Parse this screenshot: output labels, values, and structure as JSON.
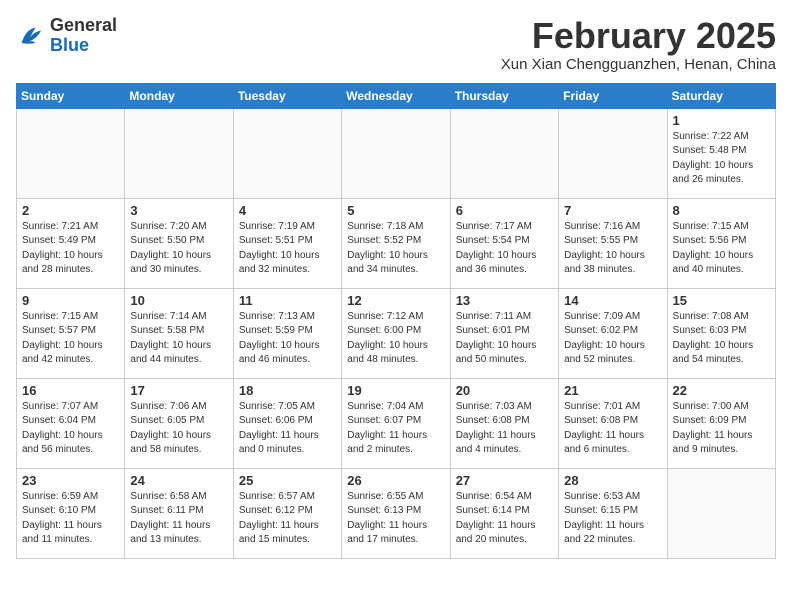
{
  "header": {
    "logo_general": "General",
    "logo_blue": "Blue",
    "month_title": "February 2025",
    "subtitle": "Xun Xian Chengguanzhen, Henan, China"
  },
  "weekdays": [
    "Sunday",
    "Monday",
    "Tuesday",
    "Wednesday",
    "Thursday",
    "Friday",
    "Saturday"
  ],
  "weeks": [
    [
      {
        "day": "",
        "info": ""
      },
      {
        "day": "",
        "info": ""
      },
      {
        "day": "",
        "info": ""
      },
      {
        "day": "",
        "info": ""
      },
      {
        "day": "",
        "info": ""
      },
      {
        "day": "",
        "info": ""
      },
      {
        "day": "1",
        "info": "Sunrise: 7:22 AM\nSunset: 5:48 PM\nDaylight: 10 hours and 26 minutes."
      }
    ],
    [
      {
        "day": "2",
        "info": "Sunrise: 7:21 AM\nSunset: 5:49 PM\nDaylight: 10 hours and 28 minutes."
      },
      {
        "day": "3",
        "info": "Sunrise: 7:20 AM\nSunset: 5:50 PM\nDaylight: 10 hours and 30 minutes."
      },
      {
        "day": "4",
        "info": "Sunrise: 7:19 AM\nSunset: 5:51 PM\nDaylight: 10 hours and 32 minutes."
      },
      {
        "day": "5",
        "info": "Sunrise: 7:18 AM\nSunset: 5:52 PM\nDaylight: 10 hours and 34 minutes."
      },
      {
        "day": "6",
        "info": "Sunrise: 7:17 AM\nSunset: 5:54 PM\nDaylight: 10 hours and 36 minutes."
      },
      {
        "day": "7",
        "info": "Sunrise: 7:16 AM\nSunset: 5:55 PM\nDaylight: 10 hours and 38 minutes."
      },
      {
        "day": "8",
        "info": "Sunrise: 7:15 AM\nSunset: 5:56 PM\nDaylight: 10 hours and 40 minutes."
      }
    ],
    [
      {
        "day": "9",
        "info": "Sunrise: 7:15 AM\nSunset: 5:57 PM\nDaylight: 10 hours and 42 minutes."
      },
      {
        "day": "10",
        "info": "Sunrise: 7:14 AM\nSunset: 5:58 PM\nDaylight: 10 hours and 44 minutes."
      },
      {
        "day": "11",
        "info": "Sunrise: 7:13 AM\nSunset: 5:59 PM\nDaylight: 10 hours and 46 minutes."
      },
      {
        "day": "12",
        "info": "Sunrise: 7:12 AM\nSunset: 6:00 PM\nDaylight: 10 hours and 48 minutes."
      },
      {
        "day": "13",
        "info": "Sunrise: 7:11 AM\nSunset: 6:01 PM\nDaylight: 10 hours and 50 minutes."
      },
      {
        "day": "14",
        "info": "Sunrise: 7:09 AM\nSunset: 6:02 PM\nDaylight: 10 hours and 52 minutes."
      },
      {
        "day": "15",
        "info": "Sunrise: 7:08 AM\nSunset: 6:03 PM\nDaylight: 10 hours and 54 minutes."
      }
    ],
    [
      {
        "day": "16",
        "info": "Sunrise: 7:07 AM\nSunset: 6:04 PM\nDaylight: 10 hours and 56 minutes."
      },
      {
        "day": "17",
        "info": "Sunrise: 7:06 AM\nSunset: 6:05 PM\nDaylight: 10 hours and 58 minutes."
      },
      {
        "day": "18",
        "info": "Sunrise: 7:05 AM\nSunset: 6:06 PM\nDaylight: 11 hours and 0 minutes."
      },
      {
        "day": "19",
        "info": "Sunrise: 7:04 AM\nSunset: 6:07 PM\nDaylight: 11 hours and 2 minutes."
      },
      {
        "day": "20",
        "info": "Sunrise: 7:03 AM\nSunset: 6:08 PM\nDaylight: 11 hours and 4 minutes."
      },
      {
        "day": "21",
        "info": "Sunrise: 7:01 AM\nSunset: 6:08 PM\nDaylight: 11 hours and 6 minutes."
      },
      {
        "day": "22",
        "info": "Sunrise: 7:00 AM\nSunset: 6:09 PM\nDaylight: 11 hours and 9 minutes."
      }
    ],
    [
      {
        "day": "23",
        "info": "Sunrise: 6:59 AM\nSunset: 6:10 PM\nDaylight: 11 hours and 11 minutes."
      },
      {
        "day": "24",
        "info": "Sunrise: 6:58 AM\nSunset: 6:11 PM\nDaylight: 11 hours and 13 minutes."
      },
      {
        "day": "25",
        "info": "Sunrise: 6:57 AM\nSunset: 6:12 PM\nDaylight: 11 hours and 15 minutes."
      },
      {
        "day": "26",
        "info": "Sunrise: 6:55 AM\nSunset: 6:13 PM\nDaylight: 11 hours and 17 minutes."
      },
      {
        "day": "27",
        "info": "Sunrise: 6:54 AM\nSunset: 6:14 PM\nDaylight: 11 hours and 20 minutes."
      },
      {
        "day": "28",
        "info": "Sunrise: 6:53 AM\nSunset: 6:15 PM\nDaylight: 11 hours and 22 minutes."
      },
      {
        "day": "",
        "info": ""
      }
    ]
  ]
}
